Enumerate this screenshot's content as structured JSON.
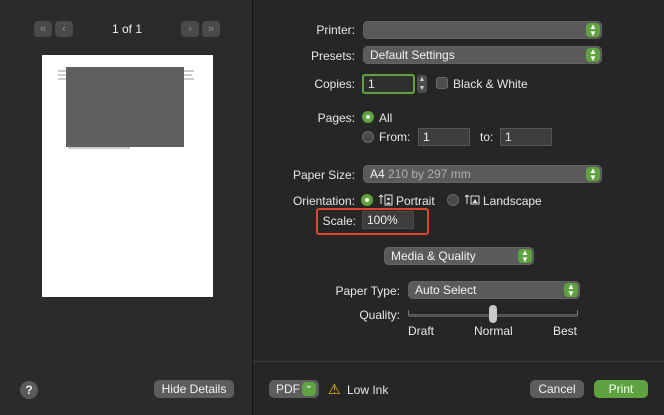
{
  "preview": {
    "page_indicator": "1 of 1",
    "first_page": "«",
    "prev_page": "‹",
    "next_page": "›",
    "last_page": "»",
    "help_label": "?",
    "hide_details_label": "Hide Details"
  },
  "printer": {
    "label": "Printer:",
    "value": ""
  },
  "presets": {
    "label": "Presets:",
    "value": "Default Settings"
  },
  "copies": {
    "label": "Copies:",
    "value": "1",
    "bw_label": "Black & White",
    "bw_checked": false
  },
  "pages": {
    "label": "Pages:",
    "all_label": "All",
    "from_label": "From:",
    "to_label": "to:",
    "from_value": "1",
    "to_value": "1",
    "selected": "All"
  },
  "paper_size": {
    "label": "Paper Size:",
    "name": "A4",
    "dimensions": "210 by 297 mm"
  },
  "orientation": {
    "label": "Orientation:",
    "portrait_label": "Portrait",
    "landscape_label": "Landscape",
    "selected": "Portrait"
  },
  "scale": {
    "label": "Scale:",
    "value": "100%"
  },
  "section": {
    "value": "Media & Quality"
  },
  "paper_type": {
    "label": "Paper Type:",
    "value": "Auto Select"
  },
  "quality": {
    "label": "Quality:",
    "min_label": "Draft",
    "mid_label": "Normal",
    "max_label": "Best",
    "selected": "Normal"
  },
  "footer": {
    "pdf_label": "PDF",
    "pdf_arrow": "⌄",
    "warning_icon": "⚠",
    "low_ink_label": "Low Ink",
    "cancel_label": "Cancel",
    "print_label": "Print"
  },
  "colors": {
    "accent": "#5fa340",
    "highlight": "#e0462e"
  }
}
